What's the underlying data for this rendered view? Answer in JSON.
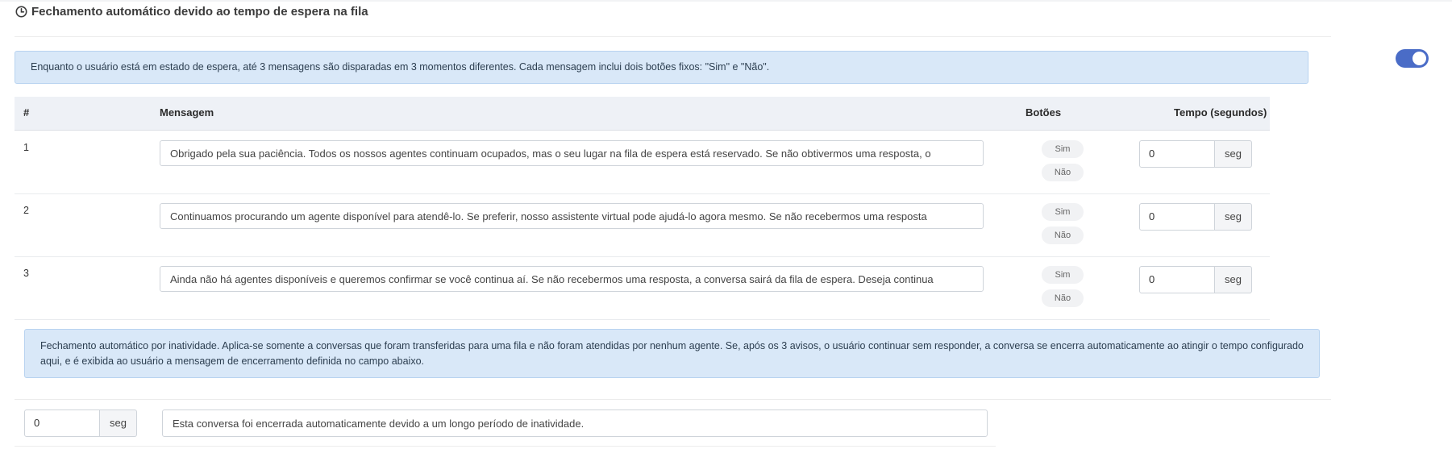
{
  "section": {
    "title": "Fechamento automático devido ao tempo de espera na fila",
    "icon": "clock-icon",
    "toggle_on": true
  },
  "info_top": "Enquanto o usuário está em estado de espera, até 3 mensagens são disparadas em 3 momentos diferentes. Cada mensagem inclui dois botões fixos: \"Sim\" e \"Não\".",
  "table": {
    "headers": {
      "num": "#",
      "message": "Mensagem",
      "buttons": "Botões",
      "time": "Tempo (segundos)"
    },
    "rows": [
      {
        "num": "1",
        "message": "Obrigado pela sua paciência. Todos os nossos agentes continuam ocupados, mas o seu lugar na fila de espera está reservado. Se não obtivermos uma resposta, o",
        "btn_yes": "Sim",
        "btn_no": "Não",
        "time": "0",
        "unit": "seg"
      },
      {
        "num": "2",
        "message": "Continuamos procurando um agente disponível para atendê-lo. Se preferir, nosso assistente virtual pode ajudá-lo agora mesmo. Se não recebermos uma resposta",
        "btn_yes": "Sim",
        "btn_no": "Não",
        "time": "0",
        "unit": "seg"
      },
      {
        "num": "3",
        "message": "Ainda não há agentes disponíveis e queremos confirmar se você continua aí. Se não recebermos uma resposta, a conversa sairá da fila de espera. Deseja continua",
        "btn_yes": "Sim",
        "btn_no": "Não",
        "time": "0",
        "unit": "seg"
      }
    ]
  },
  "info_bottom": "Fechamento automático por inatividade. Aplica-se somente a conversas que foram transferidas para uma fila e não foram atendidas por nenhum agente. Se, após os 3 avisos, o usuário continuar sem responder, a conversa se encerra automaticamente ao atingir o tempo configurado aqui, e é exibida ao usuário a mensagem de encerramento definida no campo abaixo.",
  "closing": {
    "time": "0",
    "unit": "seg",
    "message": "Esta conversa foi encerrada automaticamente devido a um longo período de inatividade."
  }
}
